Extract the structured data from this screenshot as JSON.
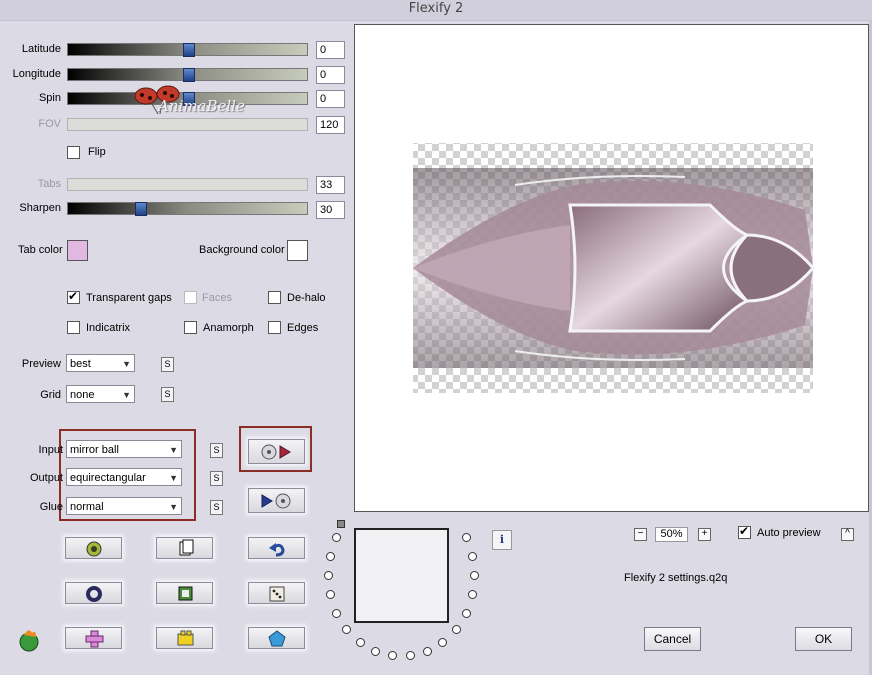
{
  "window": {
    "title": "Flexify 2"
  },
  "sliders": [
    {
      "id": "latitude",
      "label": "Latitude",
      "value": "0",
      "level": 0.5,
      "enabled": true
    },
    {
      "id": "longitude",
      "label": "Longitude",
      "value": "0",
      "level": 0.5,
      "enabled": true
    },
    {
      "id": "spin",
      "label": "Spin",
      "value": "0",
      "level": 0.5,
      "enabled": true
    },
    {
      "id": "fov",
      "label": "FOV",
      "value": "120",
      "level": null,
      "enabled": false
    },
    {
      "id": "tabs",
      "label": "Tabs",
      "value": "33",
      "level": null,
      "enabled": false
    },
    {
      "id": "sharpen",
      "label": "Sharpen",
      "value": "30",
      "level": 0.3,
      "enabled": true
    }
  ],
  "flip": {
    "label": "Flip",
    "checked": false
  },
  "colors": {
    "tab_color_label": "Tab color",
    "tab_color": "#e0b8e0",
    "background_color_label": "Background color",
    "background_color": "#ffffff"
  },
  "options": {
    "transparent_gaps": {
      "label": "Transparent gaps",
      "checked": true
    },
    "faces": {
      "label": "Faces",
      "checked": false,
      "enabled": false
    },
    "de_halo": {
      "label": "De-halo",
      "checked": false
    },
    "indicatrix": {
      "label": "Indicatrix",
      "checked": false
    },
    "anamorph": {
      "label": "Anamorph",
      "checked": false
    },
    "edges": {
      "label": "Edges",
      "checked": false
    }
  },
  "preview_quality": {
    "label": "Preview",
    "value": "best",
    "s": "S"
  },
  "grid": {
    "label": "Grid",
    "value": "none",
    "s": "S"
  },
  "mapping": {
    "input": {
      "label": "Input",
      "value": "mirror ball",
      "s": "S"
    },
    "output": {
      "label": "Output",
      "value": "equirectangular",
      "s": "S"
    },
    "glue": {
      "label": "Glue",
      "value": "normal",
      "s": "S"
    }
  },
  "watermark": {
    "text": "AnimaBelle"
  },
  "zoom": {
    "minus": "−",
    "value": "50%",
    "plus": "+"
  },
  "auto_preview": {
    "label": "Auto preview",
    "checked": true,
    "expand": "^"
  },
  "info_icon": "i",
  "settings_file": "Flexify 2 settings.q2q",
  "buttons": {
    "cancel": "Cancel",
    "ok": "OK"
  }
}
